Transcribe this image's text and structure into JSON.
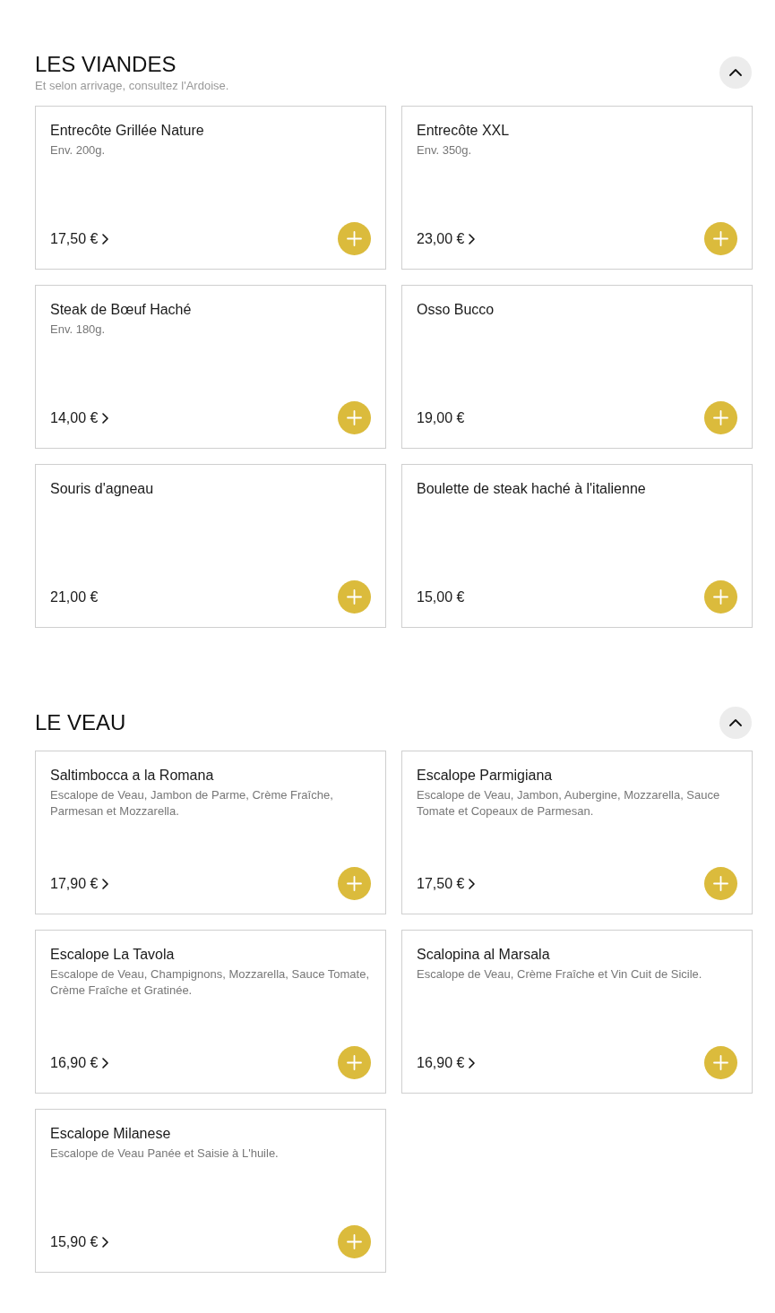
{
  "sections": [
    {
      "title": "LES VIANDES",
      "subtitle": "Et selon arrivage, consultez l'Ardoise.",
      "expanded": true,
      "items": [
        {
          "name": "Entrecôte Grillée Nature",
          "description": "Env. 200g.",
          "price": "17,50 €",
          "has_options": true
        },
        {
          "name": "Entrecôte XXL",
          "description": "Env. 350g.",
          "price": "23,00 €",
          "has_options": true
        },
        {
          "name": "Steak de Bœuf Haché",
          "description": "Env. 180g.",
          "price": "14,00 €",
          "has_options": true
        },
        {
          "name": "Osso Bucco",
          "price": "19,00 €",
          "has_options": false
        },
        {
          "name": "Souris d'agneau",
          "price": "21,00 €",
          "has_options": false
        },
        {
          "name": "Boulette de steak haché à l'italienne",
          "price": "15,00 €",
          "has_options": false
        }
      ]
    },
    {
      "title": "LE VEAU",
      "expanded": true,
      "items": [
        {
          "name": "Saltimbocca a la Romana",
          "description": "Escalope de Veau, Jambon de Parme, Crème Fraîche, Parmesan et Mozzarella.",
          "price": "17,90 €",
          "has_options": true
        },
        {
          "name": "Escalope Parmigiana",
          "description": "Escalope de Veau, Jambon, Aubergine, Mozzarella, Sauce Tomate et Copeaux de Parmesan.",
          "price": "17,50 €",
          "has_options": true
        },
        {
          "name": "Escalope La Tavola",
          "description": "Escalope de Veau, Champignons, Mozzarella, Sauce Tomate, Crème Fraîche et Gratinée.",
          "price": "16,90 €",
          "has_options": true
        },
        {
          "name": "Scalopina al Marsala",
          "description": "Escalope de Veau, Crème Fraîche et Vin Cuit de Sicile.",
          "price": "16,90 €",
          "has_options": true
        },
        {
          "name": "Escalope Milanese",
          "description": "Escalope de Veau Panée et Saisie à L'huile.",
          "price": "15,90 €",
          "has_options": true
        }
      ]
    }
  ]
}
